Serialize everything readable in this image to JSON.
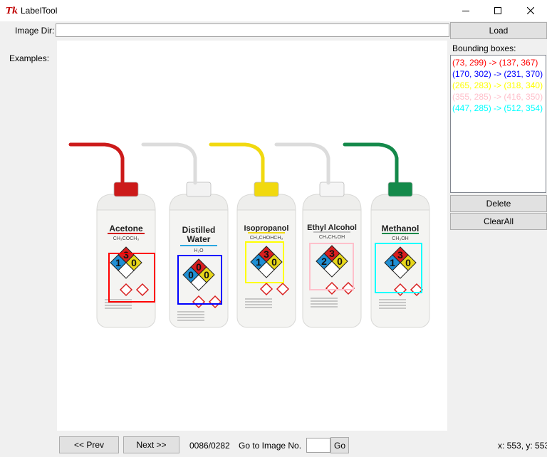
{
  "window": {
    "title": "LabelTool",
    "app_icon_text": "Tk",
    "icon": "tk-feather-icon"
  },
  "form": {
    "image_dir_label": "Image Dir:",
    "image_dir_value": "",
    "load_label": "Load",
    "examples_label": "Examples:"
  },
  "bbox_panel": {
    "label": "Bounding boxes:",
    "items": [
      {
        "text": "(73, 299) -> (137, 367)",
        "color": "#ff0000"
      },
      {
        "text": "(170, 302) -> (231, 370)",
        "color": "#0000ff"
      },
      {
        "text": "(265, 283) -> (318, 340)",
        "color": "#ffff00"
      },
      {
        "text": "(355, 285) -> (416, 350)",
        "color": "#ffc0cb"
      },
      {
        "text": "(447, 285) -> (512, 354)",
        "color": "#00ffff"
      }
    ],
    "delete_label": "Delete",
    "clearall_label": "ClearAll"
  },
  "canvas": {
    "bottles": [
      {
        "name": "Acetone",
        "formula": "CH₃COCH₃",
        "cap_color": "#cc1a1a",
        "stripe_color": "#d11a1a",
        "nfpa": [
          "3",
          "1",
          "0",
          ""
        ]
      },
      {
        "name": "Distilled",
        "name2": "Water",
        "formula": "H₂O",
        "cap_color": "#f2f2f2",
        "stripe_color": "#2aa6e0",
        "nfpa": [
          "0",
          "0",
          "0",
          ""
        ]
      },
      {
        "name": "Isopropanol",
        "formula": "CH₃CHOHCH₃",
        "cap_color": "#f1d90f",
        "stripe_color": "#f1d90f",
        "nfpa": [
          "3",
          "1",
          "0",
          ""
        ]
      },
      {
        "name": "Ethyl Alcohol",
        "formula": "CH₃CH₂OH",
        "cap_color": "#f5f5f5",
        "stripe_color": "#c0c0c0",
        "nfpa": [
          "3",
          "2",
          "0",
          ""
        ]
      },
      {
        "name": "Methanol",
        "formula": "CH₃OH",
        "cap_color": "#14894a",
        "stripe_color": "#14894a",
        "nfpa": [
          "3",
          "1",
          "0",
          ""
        ]
      }
    ]
  },
  "nav": {
    "prev_label": "<< Prev",
    "next_label": "Next >>",
    "progress": "0086/0282",
    "goto_label": "Go to Image No.",
    "goto_value": "",
    "go_label": "Go"
  },
  "status": {
    "coords": "x: 553, y: 553"
  }
}
